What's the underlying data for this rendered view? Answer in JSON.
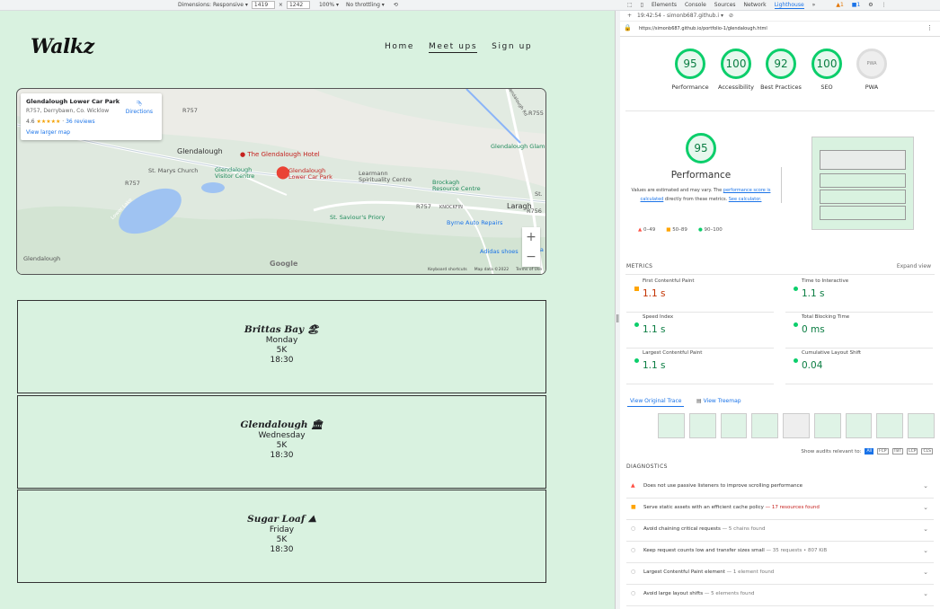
{
  "device_toolbar": {
    "dimensions_label": "Dimensions: Responsive ▾",
    "width": "1419",
    "height": "1242",
    "zoom": "100% ▾",
    "throttle": "No throttling ▾"
  },
  "site": {
    "logo": "Walkz",
    "nav": [
      "Home",
      "Meet ups",
      "Sign up"
    ],
    "active_nav": "Meet ups"
  },
  "map": {
    "card_title": "Glendalough Lower Car Park",
    "card_address": "R757, Derrybawn, Co. Wicklow",
    "rating": "4.6",
    "stars": "★★★★★",
    "reviews": "36 reviews",
    "view_larger": "View larger map",
    "directions": "Directions",
    "labels": {
      "glendalough": "Glendalough",
      "hotel": "The Glendalough Hotel",
      "st_marys": "St. Marys Church",
      "visitor": "Glendalough Visitor Centre",
      "car_park": "Glendalough Lower Car Park",
      "learmann": "Learmann Spirituality Centre",
      "brockagh": "Brockagh Resource Centre",
      "laragh": "Laragh",
      "knockfin": "KNOCKFIN",
      "st_saviours": "St. Saviour's Priory",
      "byrne": "Byrne Auto Repairs",
      "adidas": "Adidas shoes",
      "lower_lake": "Lower Lake",
      "glamp": "Glendalough Glam",
      "r757": "R757",
      "r755": "R755",
      "r756": "R756",
      "bottom_left": "Glendalough",
      "st": "St.",
      "ja": "Ja",
      "rd": "Glendalough Rd"
    },
    "google": "Google",
    "footer": [
      "Keyboard shortcuts",
      "Map data ©2022",
      "Terms of Use"
    ],
    "zoom_in": "+",
    "zoom_out": "−"
  },
  "meetups": [
    {
      "name": "Brittas Bay 🏖",
      "day": "Monday",
      "distance": "5K",
      "time": "18:30"
    },
    {
      "name": "Glendalough 🏛",
      "day": "Wednesday",
      "distance": "5K",
      "time": "18:30"
    },
    {
      "name": "Sugar Loaf ⛰",
      "day": "Friday",
      "distance": "5K",
      "time": "18:30"
    }
  ],
  "devtools": {
    "tabs": [
      "Elements",
      "Console",
      "Sources",
      "Network",
      "Lighthouse",
      "»"
    ],
    "active_tab": "Lighthouse",
    "warn_count": "1",
    "info_count": "1",
    "report_time": "19:42:54 - simonb687.github.i ▾",
    "url": "https://simonb687.github.io/portfolio-1/glendalough.html",
    "scores": [
      {
        "value": "95",
        "label": "Performance"
      },
      {
        "value": "100",
        "label": "Accessibility"
      },
      {
        "value": "92",
        "label": "Best Practices"
      },
      {
        "value": "100",
        "label": "SEO"
      },
      {
        "value": "PWA",
        "label": "PWA"
      }
    ],
    "perf_score": "95",
    "perf_title": "Performance",
    "perf_note_a": "Values are estimated and may vary. The ",
    "perf_note_link1": "performance score is calculated",
    "perf_note_b": " directly from these metrics. ",
    "perf_note_link2": "See calculator.",
    "legend": [
      "0–49",
      "50–89",
      "90–100"
    ],
    "metrics_heading": "METRICS",
    "expand_view": "Expand view",
    "metrics": [
      {
        "label": "First Contentful Paint",
        "value": "1.1 s",
        "status": "average"
      },
      {
        "label": "Time to Interactive",
        "value": "1.1 s",
        "status": "pass"
      },
      {
        "label": "Speed Index",
        "value": "1.1 s",
        "status": "pass"
      },
      {
        "label": "Total Blocking Time",
        "value": "0 ms",
        "status": "pass"
      },
      {
        "label": "Largest Contentful Paint",
        "value": "1.1 s",
        "status": "pass"
      },
      {
        "label": "Cumulative Layout Shift",
        "value": "0.04",
        "status": "pass"
      }
    ],
    "view_trace": "View Original Trace",
    "view_treemap": "View Treemap",
    "show_audits": "Show audits relevant to:",
    "audit_filters": [
      "All",
      "FCP",
      "TBT",
      "LCP",
      "CLS"
    ],
    "diagnostics_heading": "DIAGNOSTICS",
    "diagnostics": [
      {
        "text": "Does not use passive listeners to improve scrolling performance",
        "detail": "",
        "type": "fail"
      },
      {
        "text": "Serve static assets with an efficient cache policy",
        "detail": "— 17 resources found",
        "type": "average"
      },
      {
        "text": "Avoid chaining critical requests",
        "detail": "— 5 chains found",
        "type": "info"
      },
      {
        "text": "Keep request counts low and transfer sizes small",
        "detail": "— 35 requests • 807 KiB",
        "type": "info"
      },
      {
        "text": "Largest Contentful Paint element",
        "detail": "— 1 element found",
        "type": "info"
      },
      {
        "text": "Avoid large layout shifts",
        "detail": "— 5 elements found",
        "type": "info"
      }
    ],
    "colors": {
      "pass": "#0cce6b",
      "average": "#ffa400",
      "fail": "#ff4e42",
      "link": "#1a73e8"
    }
  }
}
